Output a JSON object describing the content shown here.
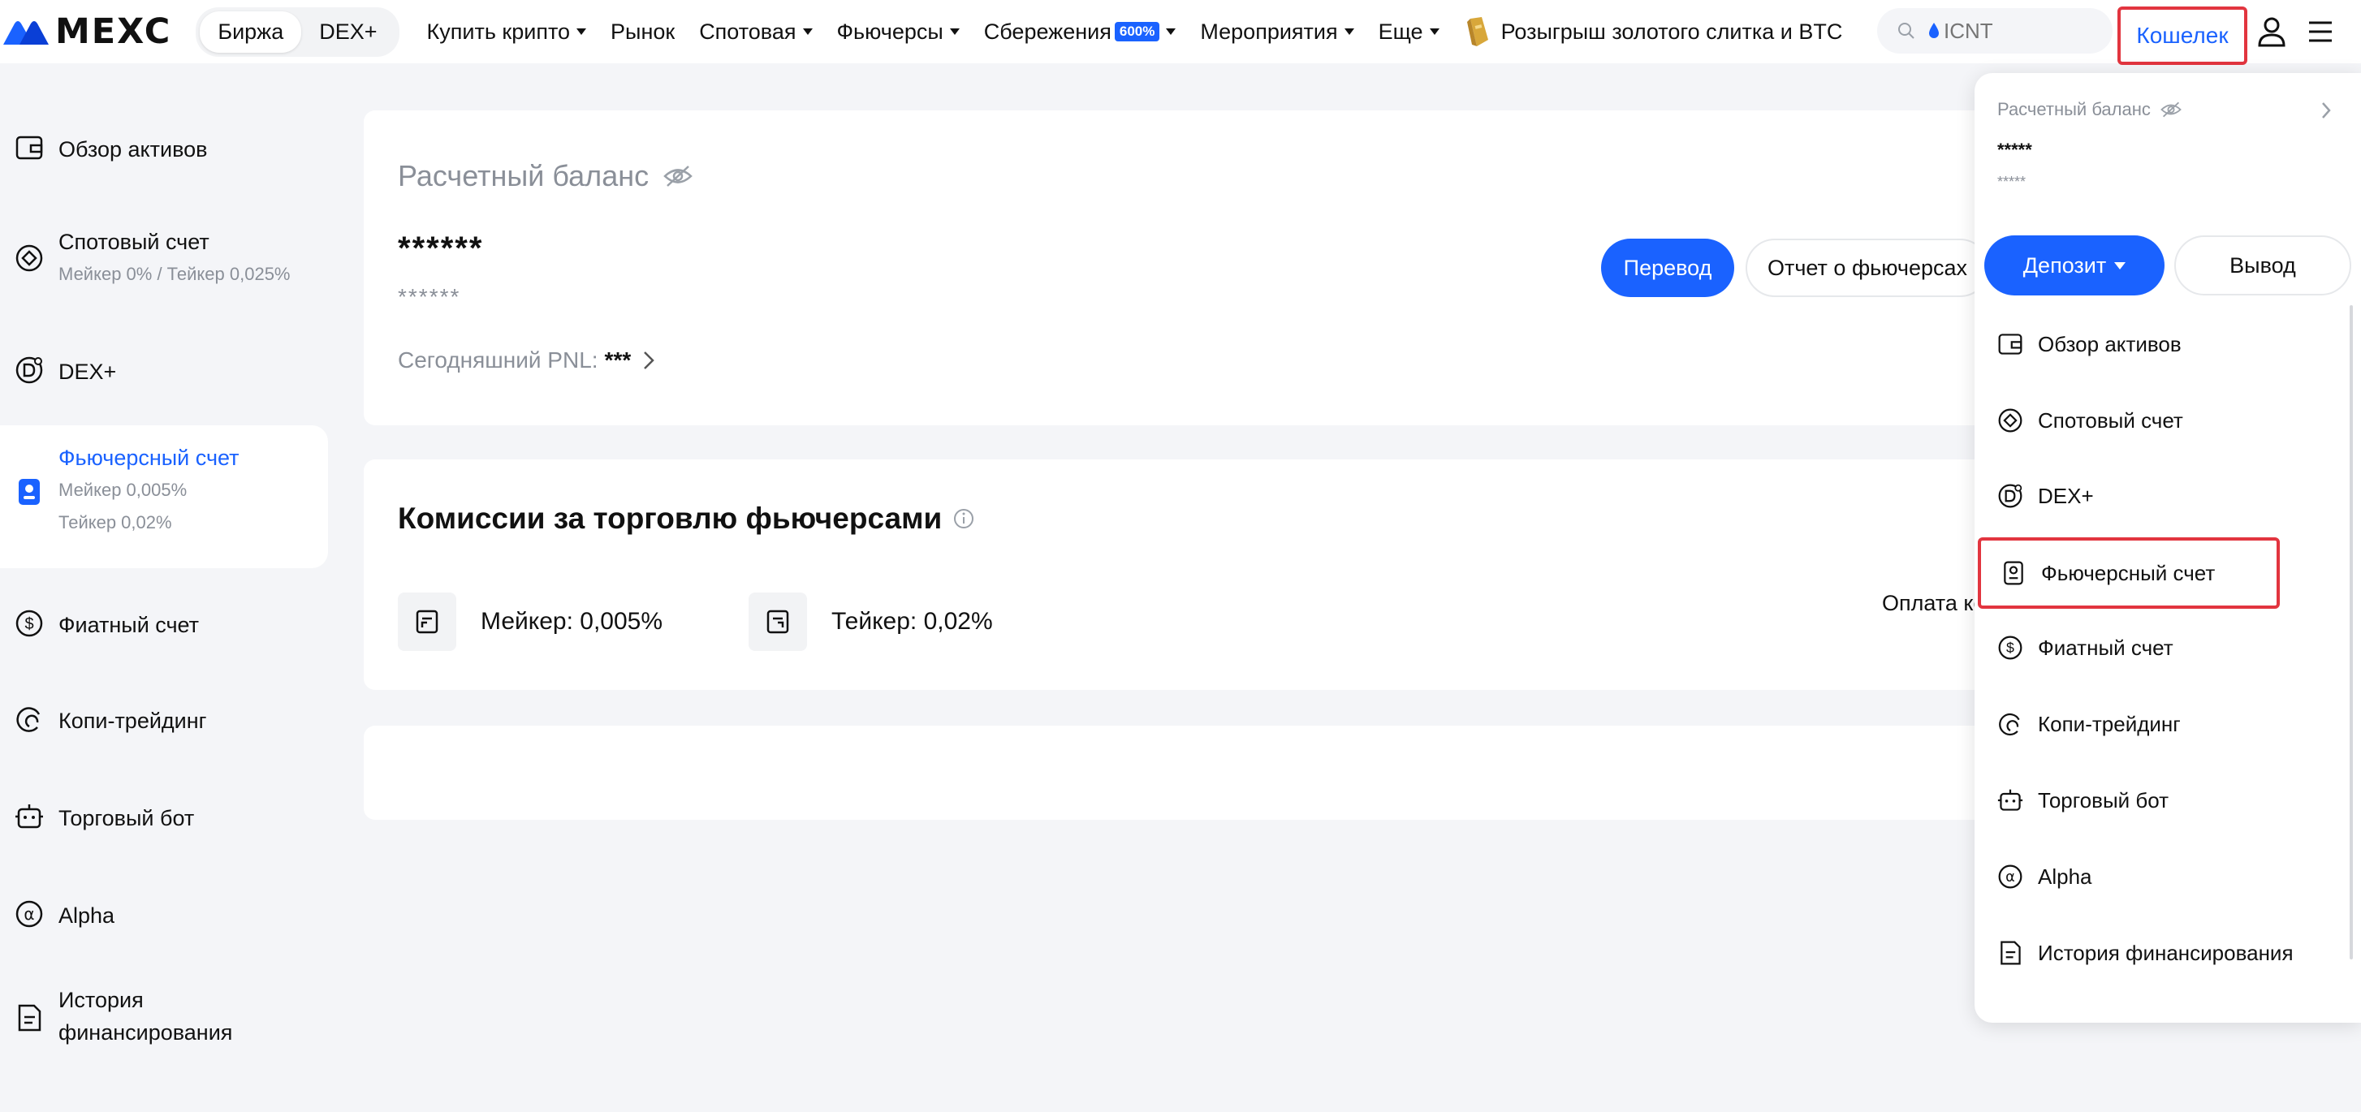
{
  "topnav": {
    "logo_text": "MEXC",
    "mode_tabs": [
      "Биржа",
      "DEX+"
    ],
    "items": [
      {
        "label": "Купить крипто",
        "caret": true
      },
      {
        "label": "Рынок",
        "caret": false
      },
      {
        "label": "Спотовая",
        "caret": true
      },
      {
        "label": "Фьючерсы",
        "caret": true
      },
      {
        "label": "Сбережения",
        "caret": true,
        "badge": "600%"
      },
      {
        "label": "Мероприятия",
        "caret": true
      },
      {
        "label": "Еще",
        "caret": true
      }
    ],
    "promo": "Розыгрыш золотого слитка и BTC",
    "search_placeholder": "ICNT",
    "wallet_label": "Кошелек"
  },
  "sidebar": {
    "items": [
      {
        "label": "Обзор активов",
        "sub": [],
        "icon": "wallet-icon"
      },
      {
        "label": "Спотовый счет",
        "sub": [
          "Мейкер 0% / Тейкер 0,025%"
        ],
        "icon": "spot-icon"
      },
      {
        "label": "DEX+",
        "sub": [],
        "icon": "dex-icon"
      },
      {
        "label": "Фьючерсный счет",
        "sub": [
          "Мейкер 0,005%",
          "Тейкер 0,02%"
        ],
        "icon": "futures-icon",
        "active": true
      },
      {
        "label": "Фиатный счет",
        "sub": [],
        "icon": "dollar-icon"
      },
      {
        "label": "Копи-трейдинг",
        "sub": [],
        "icon": "copy-trading-icon"
      },
      {
        "label": "Торговый бот",
        "sub": [],
        "icon": "bot-icon"
      },
      {
        "label": "Alpha",
        "sub": [],
        "icon": "alpha-icon"
      },
      {
        "label": "История",
        "sub": [],
        "label2": "финансирования",
        "icon": "document-icon"
      }
    ]
  },
  "balance": {
    "title": "Расчетный баланс",
    "main": "******",
    "sub": "******",
    "pnl_label": "Сегодняшний PNL:",
    "pnl_value": "***",
    "transfer_label": "Перевод",
    "report_label": "Отчет о фьючерсах"
  },
  "fees": {
    "title": "Комиссии за торговлю фьючерсами",
    "maker": "Мейкер: 0,005%",
    "taker": "Тейкер: 0,02%",
    "payment": "Оплата ко"
  },
  "dropdown": {
    "balance_title": "Расчетный баланс",
    "balance_main": "*****",
    "balance_sub": "*****",
    "deposit_label": "Депозит",
    "withdraw_label": "Вывод",
    "items": [
      {
        "label": "Обзор активов",
        "icon": "wallet-icon"
      },
      {
        "label": "Спотовый счет",
        "icon": "spot-icon"
      },
      {
        "label": "DEX+",
        "icon": "dex-icon"
      },
      {
        "label": "Фьючерсный счет",
        "icon": "futures-icon",
        "highlight": true
      },
      {
        "label": "Фиатный счет",
        "icon": "dollar-icon"
      },
      {
        "label": "Копи-трейдинг",
        "icon": "copy-trading-icon"
      },
      {
        "label": "Торговый бот",
        "icon": "bot-icon"
      },
      {
        "label": "Alpha",
        "icon": "alpha-icon"
      },
      {
        "label": "История финансирования",
        "icon": "document-icon"
      }
    ]
  },
  "colors": {
    "accent": "#1a62ff",
    "highlight_border": "#e2353f",
    "page_bg": "#f4f5f8",
    "muted_text": "#8a8f98"
  }
}
